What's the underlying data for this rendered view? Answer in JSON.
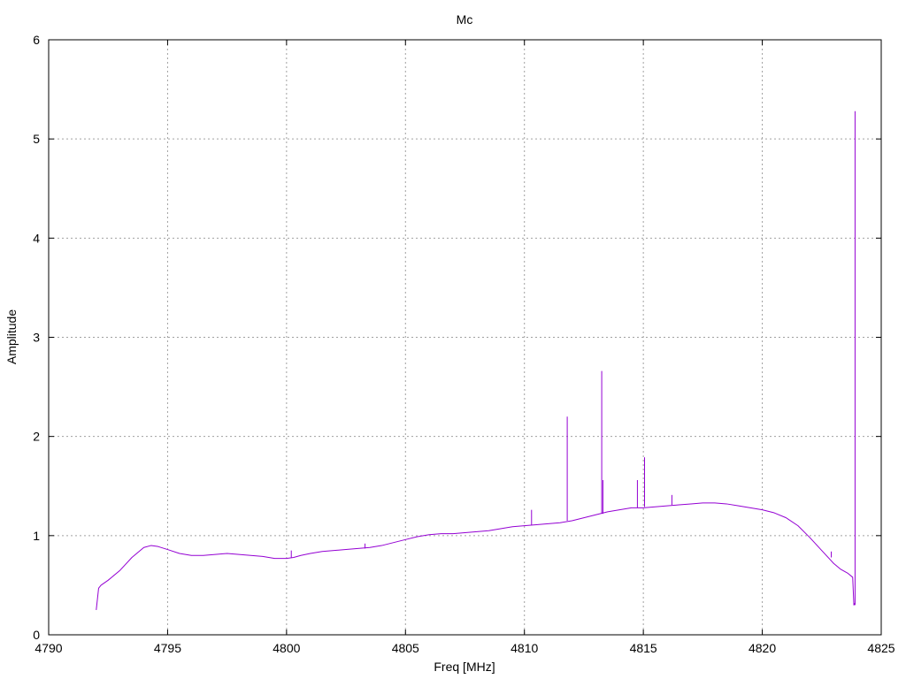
{
  "chart_data": {
    "type": "line",
    "title": "Mc",
    "xlabel": "Freq [MHz]",
    "ylabel": "Amplitude",
    "xlim": [
      4790,
      4825
    ],
    "ylim": [
      0,
      6
    ],
    "xticks": [
      4790,
      4795,
      4800,
      4805,
      4810,
      4815,
      4820,
      4825
    ],
    "yticks": [
      0,
      1,
      2,
      3,
      4,
      5,
      6
    ],
    "grid": true,
    "legend": "none",
    "colors": {
      "series": "#9400d3"
    },
    "series": [
      {
        "x": [
          4792.0,
          4792.1,
          4792.2,
          4792.5,
          4793.0,
          4793.5,
          4794.0,
          4794.3,
          4794.6,
          4795.0,
          4795.5,
          4796.0,
          4796.5,
          4797.0,
          4797.5,
          4798.0,
          4798.5,
          4799.0,
          4799.5,
          4800.0,
          4800.3,
          4800.6,
          4801.0,
          4801.5,
          4802.0,
          4802.5,
          4803.0,
          4803.5,
          4804.0,
          4804.5,
          4805.0,
          4805.5,
          4806.0,
          4806.5,
          4807.0,
          4807.5,
          4808.0,
          4808.5,
          4809.0,
          4809.5,
          4810.0,
          4810.5,
          4811.0,
          4811.5,
          4812.0,
          4812.5,
          4813.0,
          4813.5,
          4814.0,
          4814.5,
          4815.0,
          4815.5,
          4816.0,
          4816.5,
          4817.0,
          4817.5,
          4818.0,
          4818.5,
          4819.0,
          4819.5,
          4820.0,
          4820.5,
          4821.0,
          4821.5,
          4822.0,
          4822.5,
          4823.0,
          4823.3,
          4823.6,
          4823.8,
          4823.85,
          4823.9
        ],
        "values": [
          0.25,
          0.47,
          0.5,
          0.55,
          0.65,
          0.78,
          0.88,
          0.9,
          0.89,
          0.86,
          0.82,
          0.8,
          0.8,
          0.81,
          0.82,
          0.81,
          0.8,
          0.79,
          0.77,
          0.77,
          0.78,
          0.8,
          0.82,
          0.84,
          0.85,
          0.86,
          0.87,
          0.88,
          0.9,
          0.93,
          0.96,
          0.99,
          1.01,
          1.02,
          1.02,
          1.03,
          1.04,
          1.05,
          1.07,
          1.09,
          1.1,
          1.11,
          1.12,
          1.13,
          1.15,
          1.18,
          1.21,
          1.24,
          1.26,
          1.28,
          1.28,
          1.29,
          1.3,
          1.31,
          1.32,
          1.33,
          1.33,
          1.32,
          1.3,
          1.28,
          1.26,
          1.23,
          1.18,
          1.1,
          0.98,
          0.85,
          0.72,
          0.66,
          0.62,
          0.58,
          0.3,
          0.32
        ]
      }
    ],
    "spikes": [
      {
        "x": 4800.2,
        "base": 0.78,
        "peak": 0.85
      },
      {
        "x": 4803.3,
        "base": 0.87,
        "peak": 0.92
      },
      {
        "x": 4810.3,
        "base": 1.11,
        "peak": 1.26
      },
      {
        "x": 4811.8,
        "base": 1.15,
        "peak": 2.2
      },
      {
        "x": 4813.25,
        "base": 1.22,
        "peak": 2.66
      },
      {
        "x": 4813.3,
        "base": 1.22,
        "peak": 1.56
      },
      {
        "x": 4814.75,
        "base": 1.28,
        "peak": 1.56
      },
      {
        "x": 4815.05,
        "base": 1.29,
        "peak": 1.79
      },
      {
        "x": 4816.2,
        "base": 1.31,
        "peak": 1.41
      },
      {
        "x": 4822.9,
        "base": 0.78,
        "peak": 0.84
      },
      {
        "x": 4823.9,
        "base": 0.3,
        "peak": 5.28
      }
    ]
  }
}
